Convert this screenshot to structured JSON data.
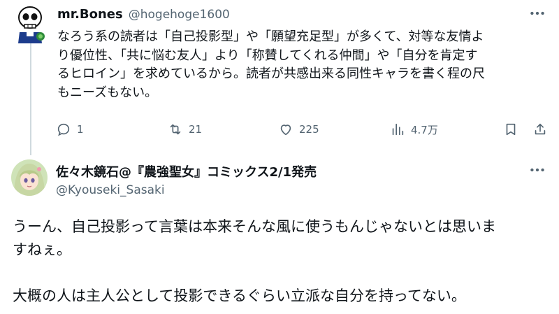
{
  "tweet1": {
    "display_name": "mr.Bones",
    "handle": "@hogehoge1600",
    "body_lines": [
      "なろう系の読者は「自己投影型」や「願望充足型」が多くて、対等な友情よ",
      "り優位性、「共に悩む友人」より「称賛してくれる仲間」や「自分を肯定す",
      "るヒロイン」を求めているから。読者が共感出来る同性キャラを書く程の尺",
      "もニーズもない。"
    ],
    "stats": {
      "replies": "1",
      "reposts": "21",
      "likes": "225",
      "views": "4.7万"
    },
    "icons": [
      "skull-avatar",
      "more-icon",
      "reply-icon",
      "repost-icon",
      "like-icon",
      "views-icon",
      "bookmark-icon",
      "share-icon"
    ]
  },
  "tweet2": {
    "display_name": "佐々木鏡石@『農強聖女』コミックス2/1発売",
    "handle": "@Kyouseki_Sasaki",
    "body_lines": [
      "うーん、自己投影って言葉は本来そんな風に使うもんじゃないとは思いま",
      "すねぇ。",
      "",
      "大概の人は主人公として投影できるぐらい立派な自分を持ってない。"
    ],
    "icons": [
      "anime-avatar",
      "more-icon"
    ]
  },
  "colors": {
    "text": "#0f1419",
    "secondary": "#536471",
    "thread_line": "#cfd9de"
  }
}
